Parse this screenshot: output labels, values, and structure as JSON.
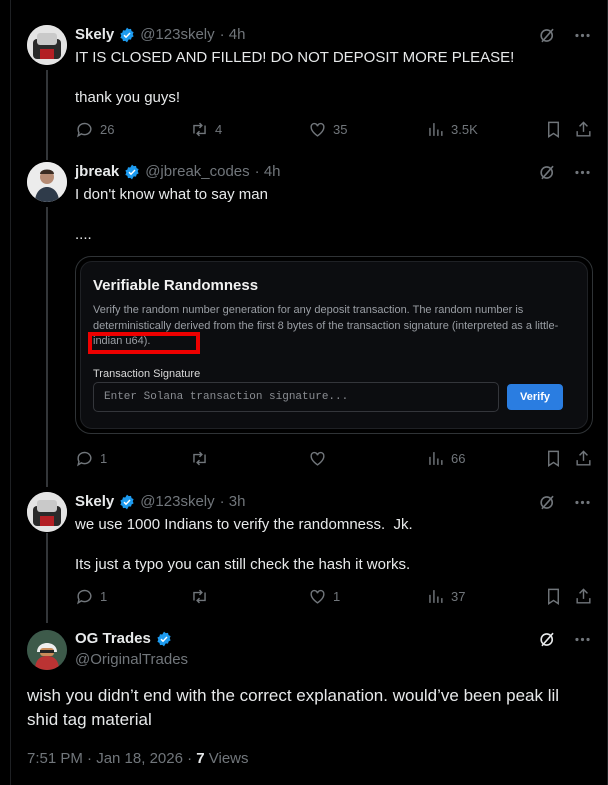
{
  "posts": [
    {
      "name": "Skely",
      "handle": "@123skely",
      "time": "· 4h",
      "text": "IT IS CLOSED AND FILLED! DO NOT DEPOSIT MORE PLEASE!\n\nthank you guys!",
      "replies": "26",
      "reposts": "4",
      "likes": "35",
      "views": "3.5K"
    },
    {
      "name": "jbreak",
      "handle": "@jbreak_codes",
      "time": "· 4h",
      "text": "I don't know what to say man\n\n....",
      "replies": "1",
      "reposts": "",
      "likes": "",
      "views": "66",
      "card": {
        "title": "Verifiable Randomness",
        "description": "Verify the random number generation for any deposit transaction. The random number is deterministically derived from the first 8 bytes of the transaction signature (interpreted as a little-indian u64).",
        "field_label": "Transaction Signature",
        "placeholder": "Enter Solana transaction signature...",
        "button": "Verify"
      }
    },
    {
      "name": "Skely",
      "handle": "@123skely",
      "time": "· 3h",
      "text": "we use 1000 Indians to verify the randomness.  Jk.\n\nIts just a typo you can still check the hash it works.",
      "replies": "1",
      "reposts": "",
      "likes": "1",
      "views": "37"
    }
  ],
  "main": {
    "name": "OG Trades",
    "handle": "@OriginalTrades",
    "text": "wish you didn’t end with the correct explanation. would’ve been peak lil shid tag material",
    "timestamp": "7:51 PM · Jan 18, 2026 · ",
    "views_count": "7",
    "views_label": " Views"
  },
  "colors": {
    "background": "#000000",
    "text": "#e7e9ea",
    "muted": "#71767b",
    "verified": "#1d9bf0",
    "verify_button": "#2a7de1",
    "highlight_box": "#ee0000"
  }
}
